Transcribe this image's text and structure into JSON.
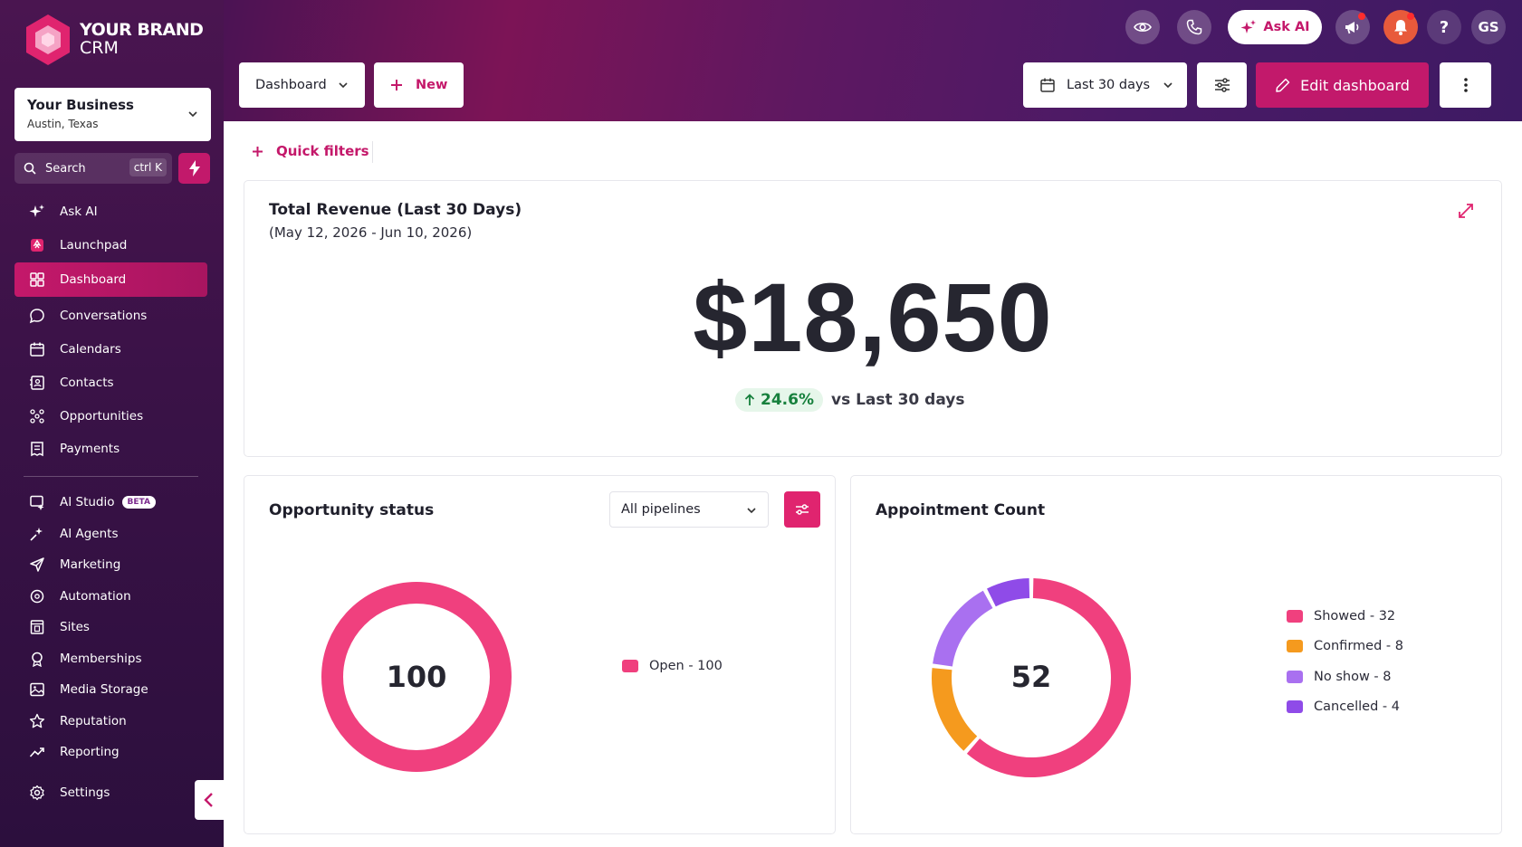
{
  "brand": {
    "line1": "YOUR BRAND",
    "line2": "CRM"
  },
  "business": {
    "name": "Your Business",
    "location": "Austin, Texas"
  },
  "search": {
    "label": "Search",
    "shortcut": "ctrl K"
  },
  "nav": {
    "items": [
      {
        "label": "Ask AI",
        "icon": "sparkle-icon"
      },
      {
        "label": "Launchpad",
        "icon": "rocket-icon"
      },
      {
        "label": "Dashboard",
        "icon": "grid-icon",
        "active": true
      },
      {
        "label": "Conversations",
        "icon": "chat-icon"
      },
      {
        "label": "Calendars",
        "icon": "calendar-icon"
      },
      {
        "label": "Contacts",
        "icon": "contact-card-icon"
      },
      {
        "label": "Opportunities",
        "icon": "network-icon"
      },
      {
        "label": "Payments",
        "icon": "receipt-icon"
      },
      {
        "label": "AI Studio",
        "icon": "ai-studio-icon",
        "badge": "BETA"
      },
      {
        "label": "AI Agents",
        "icon": "agent-icon"
      },
      {
        "label": "Marketing",
        "icon": "send-icon"
      },
      {
        "label": "Automation",
        "icon": "automation-icon"
      },
      {
        "label": "Sites",
        "icon": "sites-icon"
      },
      {
        "label": "Memberships",
        "icon": "membership-icon"
      },
      {
        "label": "Media Storage",
        "icon": "image-icon"
      },
      {
        "label": "Reputation",
        "icon": "star-icon"
      },
      {
        "label": "Reporting",
        "icon": "trend-icon"
      },
      {
        "label": "Settings",
        "icon": "gear-icon"
      }
    ]
  },
  "header": {
    "dashboard_select": "Dashboard",
    "new_label": "New",
    "date_range": "Last 30 days",
    "ask_ai": "Ask AI",
    "edit_dashboard": "Edit dashboard",
    "avatar_initials": "GS",
    "help": "?"
  },
  "quick_filters": "Quick filters",
  "revenue": {
    "title": "Total Revenue (Last 30 Days)",
    "range": "(May 12, 2026 - Jun 10, 2026)",
    "value": "$18,650",
    "delta": "24.6%",
    "delta_suffix": "vs Last 30 days"
  },
  "opportunity": {
    "title": "Opportunity status",
    "pipeline_select": "All pipelines",
    "center": "100",
    "legend": [
      {
        "label": "Open - 100",
        "color": "#f0407e"
      }
    ]
  },
  "appointments": {
    "title": "Appointment Count",
    "center": "52",
    "legend": [
      {
        "label": "Showed - 32",
        "color": "#f0407e"
      },
      {
        "label": "Confirmed - 8",
        "color": "#f59a1e"
      },
      {
        "label": "No show - 8",
        "color": "#a970f0"
      },
      {
        "label": "Cancelled - 4",
        "color": "#8f4be8"
      }
    ]
  },
  "colors": {
    "accent": "#c4186a",
    "sidebar": "#3a1247",
    "pink": "#f0407e",
    "orange": "#f59a1e",
    "purple": "#a970f0"
  },
  "chart_data": [
    {
      "type": "pie",
      "title": "Opportunity status",
      "categories": [
        "Open"
      ],
      "values": [
        100
      ]
    },
    {
      "type": "pie",
      "title": "Appointment Count",
      "categories": [
        "Showed",
        "Confirmed",
        "No show",
        "Cancelled"
      ],
      "values": [
        32,
        8,
        8,
        4
      ]
    }
  ]
}
